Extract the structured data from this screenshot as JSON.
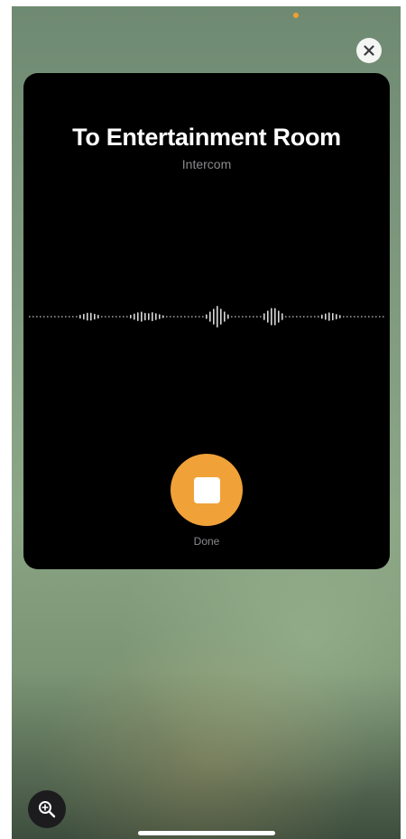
{
  "intercom": {
    "title": "To Entertainment Room",
    "subtitle": "Intercom",
    "done_label": "Done"
  },
  "icons": {
    "close": "close-icon",
    "stop": "stop-icon",
    "zoom": "zoom-in-icon"
  },
  "colors": {
    "accent": "#f0a238",
    "card_background": "#000000",
    "title_text": "#ffffff",
    "secondary_text": "#8a8a8e",
    "status_dot": "#f0a030"
  }
}
